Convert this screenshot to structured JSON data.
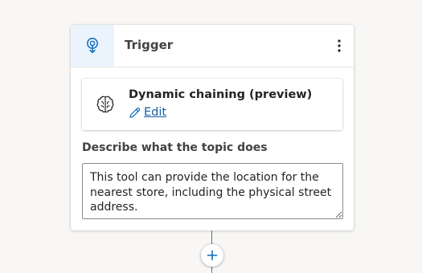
{
  "trigger_node": {
    "title": "Trigger",
    "header_icon": "trigger-bulb-icon",
    "more_icon": "more-vertical-icon",
    "accent_color": "#0f6cbd",
    "header_bg": "#ebf3fc"
  },
  "chaining_card": {
    "icon": "brain-icon",
    "title": "Dynamic chaining (preview)",
    "edit_label": "Edit",
    "edit_icon": "pencil-icon"
  },
  "description_field": {
    "label": "Describe what the topic does",
    "value": "This tool can provide the location for the nearest store, including the physical street address."
  },
  "add_node": {
    "icon": "plus-icon"
  }
}
